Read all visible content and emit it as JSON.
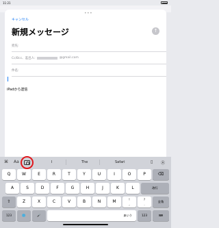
{
  "status": {
    "time": "11:21"
  },
  "compose": {
    "cancel_label": "キャンセル",
    "send_icon": "arrow-up-icon",
    "title": "新規メッセージ",
    "to_label": "宛先:",
    "cc_label": "Cc/Bcc、差出人:",
    "cc_value_suffix": "@gmail.com",
    "subject_label": "件名:",
    "signature": "iPadから送信"
  },
  "keyboard": {
    "suggestions": [
      "I",
      "The",
      "Safari"
    ],
    "toolbar_left": {
      "aa": "Aa",
      "camera_icon": "camera-icon",
      "format_icon": "format-icon"
    },
    "row1": [
      "Q",
      "W",
      "E",
      "R",
      "T",
      "Y",
      "U",
      "I",
      "O",
      "P"
    ],
    "row2": [
      "A",
      "S",
      "D",
      "F",
      "G",
      "H",
      "J",
      "K",
      "L"
    ],
    "row3": [
      "Z",
      "X",
      "C",
      "V",
      "B",
      "N",
      "M",
      "!\n,",
      "?\n."
    ],
    "shift_label": "⇧",
    "delete_label": "⌫",
    "return_label": "改行",
    "num_label": "123",
    "globe_label": "🌐",
    "mic_label": "🎤",
    "space_label": "あいう",
    "num_right_label": "123",
    "hide_label": "⌨",
    "langswitch_label": "全角"
  }
}
